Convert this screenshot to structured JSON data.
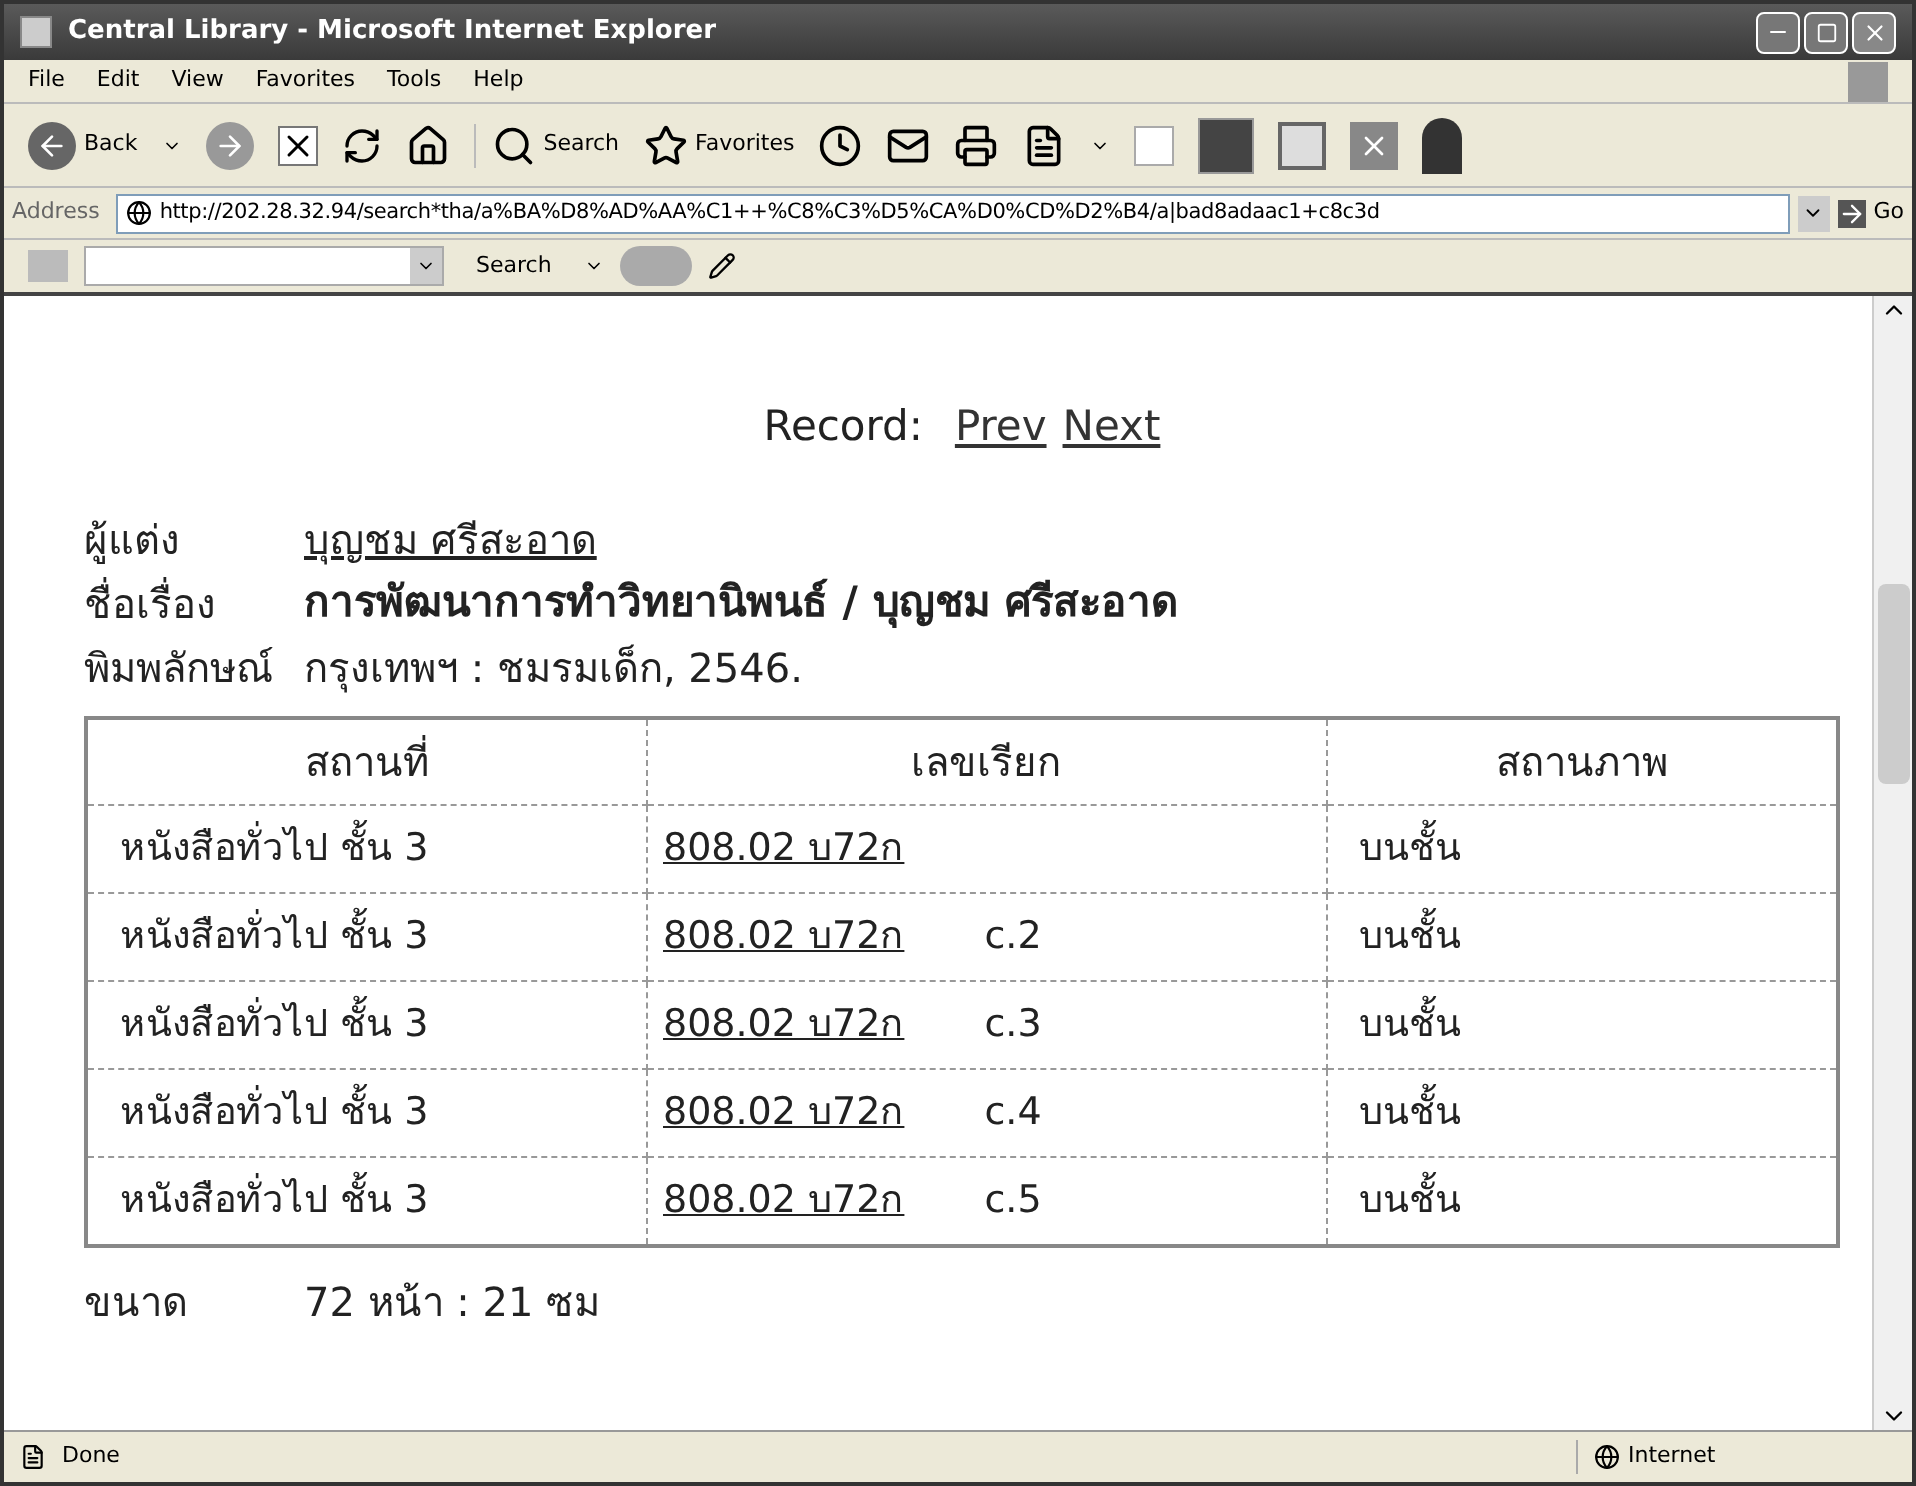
{
  "window": {
    "title": "Central Library - Microsoft Internet Explorer"
  },
  "menu": [
    "File",
    "Edit",
    "View",
    "Favorites",
    "Tools",
    "Help"
  ],
  "toolbar": {
    "back": "Back",
    "search": "Search",
    "favorites": "Favorites"
  },
  "address": {
    "label": "Address",
    "url": "http://202.28.32.94/search*tha/a%BA%D8%AD%AA%C1++%C8%C3%D5%CA%D0%CD%D2%B4/a|bad8adaac1+c8c3d",
    "go": "Go"
  },
  "search_bar": {
    "button": "Search"
  },
  "record_nav": {
    "label": "Record:",
    "links": [
      "Prev",
      "Next"
    ]
  },
  "fields": [
    {
      "label": "ผู้แต่ง",
      "value": "บุญชม ศรีสะอาด",
      "kind": "link"
    },
    {
      "label": "ชื่อเรื่อง",
      "value": "การพัฒนาการทำวิทยานิพนธ์ / บุญชม ศรีสะอาด",
      "kind": "bold"
    },
    {
      "label": "พิมพลักษณ์",
      "value": "กรุงเทพฯ : ชมรมเด็ก, 2546.",
      "kind": "plain"
    }
  ],
  "table": {
    "columns": [
      "สถานที่",
      "เลขเรียก",
      "สถานภาพ"
    ],
    "rows": [
      {
        "location": "หนังสือทั่วไป ชั้น 3",
        "call_number": "808.02 บ72ก",
        "status": "บนชั้น"
      },
      {
        "location": "หนังสือทั่วไป ชั้น 3",
        "call_number": "808.02 บ72ก",
        "copy": "c.2",
        "status": "บนชั้น"
      },
      {
        "location": "หนังสือทั่วไป ชั้น 3",
        "call_number": "808.02 บ72ก",
        "copy": "c.3",
        "status": "บนชั้น"
      },
      {
        "location": "หนังสือทั่วไป ชั้น 3",
        "call_number": "808.02 บ72ก",
        "copy": "c.4",
        "status": "บนชั้น"
      },
      {
        "location": "หนังสือทั่วไป ชั้น 3",
        "call_number": "808.02 บ72ก",
        "copy": "c.5",
        "status": "บนชั้น"
      }
    ]
  },
  "extra_field": {
    "label": "ขนาด",
    "value": "72 หน้า : 21 ซม"
  },
  "status_bar": {
    "text": "Done",
    "zone": "Internet"
  }
}
